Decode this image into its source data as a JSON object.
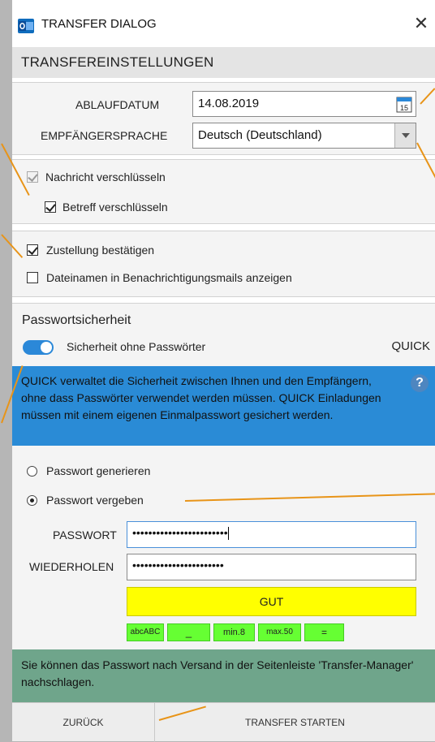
{
  "window": {
    "title": "TRANSFER DIALOG",
    "app_icon": "outlook-icon",
    "close_glyph": "✕"
  },
  "section_title": "TRANSFEREINSTELLUNGEN",
  "expiry": {
    "label": "ABLAUFDATUM",
    "value": "14.08.2019",
    "calendar_day": "15"
  },
  "language": {
    "label": "EMPFÄNGERSPRACHE",
    "value": "Deutsch (Deutschland)"
  },
  "encryption": {
    "encrypt_message": {
      "label": "Nachricht verschlüsseln",
      "checked": true,
      "disabled": true
    },
    "encrypt_subject": {
      "label": "Betreff verschlüsseln",
      "checked": true
    }
  },
  "delivery": {
    "confirm_delivery": {
      "label": "Zustellung bestätigen",
      "checked": true
    },
    "show_filenames": {
      "label": "Dateinamen in Benachrichtigungsmails anzeigen",
      "checked": false
    }
  },
  "password_security": {
    "heading": "Passwortsicherheit",
    "toggle_label": "Sicherheit ohne Passwörter",
    "toggle_on": true,
    "mode": "QUICK",
    "info_text": "QUICK verwaltet die Sicherheit zwischen Ihnen und den Empfängern, ohne dass Passwörter verwendet werden müssen. QUICK Einladungen müssen mit einem eigenen Einmalpasswort gesichert werden.",
    "help_glyph": "?"
  },
  "password_options": {
    "generate": {
      "label": "Passwort generieren",
      "selected": false
    },
    "assign": {
      "label": "Passwort vergeben",
      "selected": true
    }
  },
  "password": {
    "label": "PASSWORT",
    "value": "••••••••••••••••••••••••"
  },
  "repeat": {
    "label": "WIEDERHOLEN",
    "value": "•••••••••••••••••••••••"
  },
  "strength": {
    "label": "GUT",
    "color": "#ffff00"
  },
  "rules": [
    "abcABC",
    "_",
    "min.8",
    "max.50",
    "="
  ],
  "note": "Sie können das Passwort nach Versand in der Seitenleiste 'Transfer-Manager' nachschlagen.",
  "buttons": {
    "back": "ZURÜCK",
    "start": "TRANSFER STARTEN"
  },
  "colors": {
    "accent": "#2b88d8",
    "info_bg": "#2a8bd6",
    "note_bg": "#6fa58b",
    "callout": "#e89418",
    "rule_chip": "#66ff33"
  }
}
